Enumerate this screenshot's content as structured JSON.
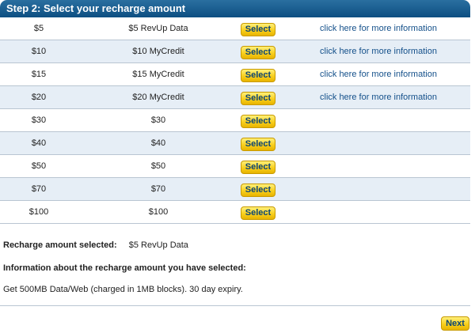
{
  "header": {
    "title": "Step 2: Select your recharge amount"
  },
  "rows": [
    {
      "amount": "$5",
      "description": "$5 RevUp Data",
      "button": "Select",
      "more": "click here for more information"
    },
    {
      "amount": "$10",
      "description": "$10 MyCredit",
      "button": "Select",
      "more": "click here for more information"
    },
    {
      "amount": "$15",
      "description": "$15 MyCredit",
      "button": "Select",
      "more": "click here for more information"
    },
    {
      "amount": "$20",
      "description": "$20 MyCredit",
      "button": "Select",
      "more": "click here for more information"
    },
    {
      "amount": "$30",
      "description": "$30",
      "button": "Select",
      "more": ""
    },
    {
      "amount": "$40",
      "description": "$40",
      "button": "Select",
      "more": ""
    },
    {
      "amount": "$50",
      "description": "$50",
      "button": "Select",
      "more": ""
    },
    {
      "amount": "$70",
      "description": "$70",
      "button": "Select",
      "more": ""
    },
    {
      "amount": "$100",
      "description": "$100",
      "button": "Select",
      "more": ""
    }
  ],
  "summary": {
    "selected_label": "Recharge amount selected:",
    "selected_value": "$5 RevUp Data",
    "info_heading": "Information about the recharge amount you have selected:",
    "info_text": "Get 500MB Data/Web (charged in 1MB blocks). 30 day expiry."
  },
  "footer": {
    "next_label": "Next"
  },
  "colors": {
    "header_bg": "#0d4f82",
    "row_alt_bg": "#e6eef6",
    "button_yellow": "#f8cf1d",
    "link_blue": "#14508a"
  }
}
